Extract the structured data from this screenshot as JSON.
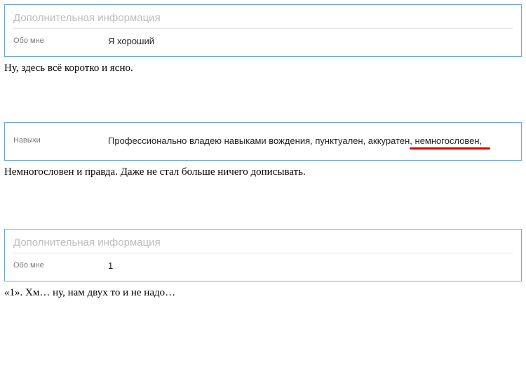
{
  "card1": {
    "header": "Дополнительная информация",
    "label": "Обо мне",
    "value": "Я хороший"
  },
  "comment1": "Ну, здесь всё коротко и ясно.",
  "card2": {
    "label": "Навыки",
    "value": "Профессионально владею навыками вождения, пунктуален, аккуратен, немногословен,"
  },
  "comment2": "Немногословен и правда. Даже не стал больше ничего дописывать.",
  "card3": {
    "header": "Дополнительная информация",
    "label": "Обо мне",
    "value": "1"
  },
  "comment3": "«1». Хм… ну, нам двух то и не надо…"
}
